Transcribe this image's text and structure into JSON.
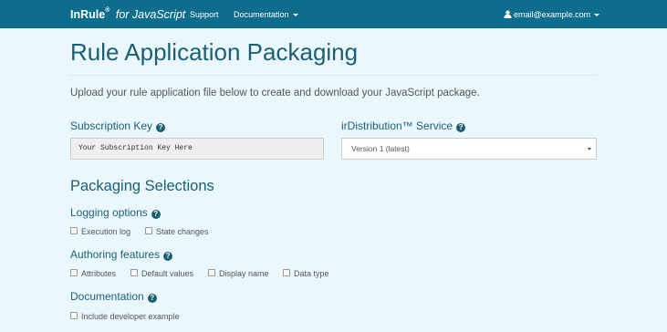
{
  "navbar": {
    "brand": "InRule",
    "brand_reg": "®",
    "brand_sub": "for JavaScript",
    "links": {
      "support": "Support",
      "documentation": "Documentation"
    },
    "user_email": "email@example.com",
    "colors": {
      "background": "#0e6d8c",
      "text": "#ffffff"
    }
  },
  "main": {
    "title": "Rule Application Packaging",
    "lead": "Upload your rule application file below to create and download your JavaScript package.",
    "subscription": {
      "label": "Subscription Key",
      "value": "Your Subscription Key Here"
    },
    "distribution": {
      "label": "irDistribution™ Service",
      "selected": "Version 1 (latest)"
    },
    "packaging": {
      "title": "Packaging Selections",
      "logging": {
        "label": "Logging options",
        "options": [
          "Execution log",
          "State changes"
        ]
      },
      "authoring": {
        "label": "Authoring features",
        "options": [
          "Attributes",
          "Default values",
          "Display name",
          "Data type"
        ]
      },
      "documentation": {
        "label": "Documentation",
        "options": [
          "Include developer example"
        ]
      }
    },
    "colors": {
      "background": "#eaf8fd",
      "heading": "#1c5f74"
    }
  },
  "icons": {
    "help": "question-circle-icon",
    "user": "user-icon",
    "dropdown": "caret-down-icon",
    "help_glyph": "?"
  }
}
